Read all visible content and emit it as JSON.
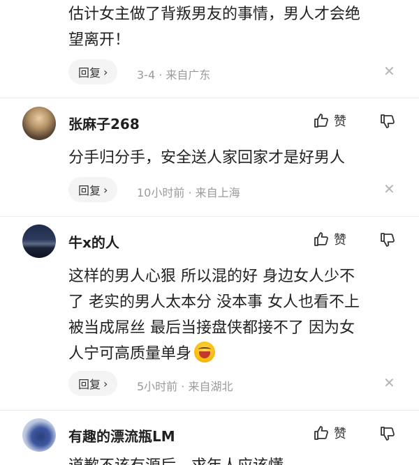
{
  "comments": [
    {
      "text_lines": [
        "估计女主做了背叛男友的事情，男人才会绝",
        "望离开！"
      ],
      "reply_label": "回复",
      "meta": "3-4 · 来自广东"
    },
    {
      "username": "张麻子268",
      "like_label": "赞",
      "text_lines": [
        "分手归分手，安全送人家回家才是好男人"
      ],
      "reply_label": "回复",
      "meta": "10小时前 · 来自上海"
    },
    {
      "username": "牛x的人",
      "like_label": "赞",
      "text_lines": [
        "这样的男人心狠 所以混的好 身边女人少不",
        "了 老实的男人太本分 没本事 女人也看不上",
        "被当成屌丝 最后当接盘侠都接不了 因为女",
        "人宁可高质量单身"
      ],
      "reply_label": "回复",
      "meta": "5小时前 · 来自湖北"
    },
    {
      "username": "有趣的漂流瓶LM",
      "like_label": "赞",
      "text_lines": [
        "道歉不该有源后，求年人应该懂"
      ]
    }
  ],
  "icons": {
    "reply_chevron": "chevron-right-icon",
    "close": "close-icon",
    "like": "thumbs-up-icon",
    "dislike": "thumbs-down-icon",
    "emoji": "laughing-emoji-icon"
  }
}
